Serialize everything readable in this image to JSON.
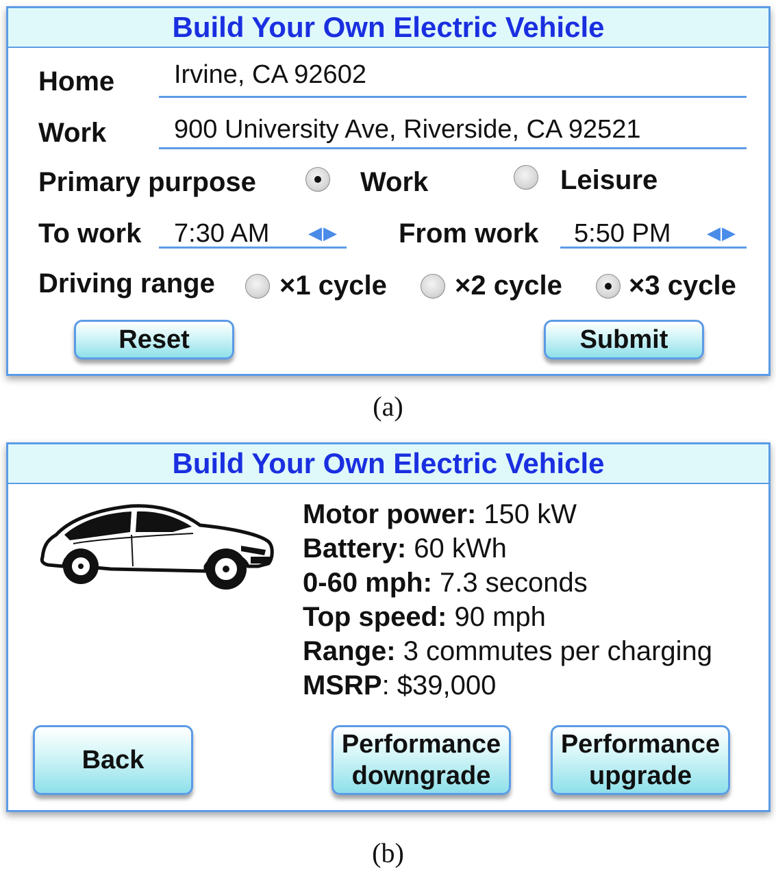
{
  "panel_a": {
    "title": "Build Your Own Electric Vehicle",
    "home_label": "Home",
    "home_value": "Irvine, CA 92602",
    "work_label": "Work",
    "work_value": "900 University Ave, Riverside, CA 92521",
    "purpose_label": "Primary purpose",
    "purpose_options": [
      "Work",
      "Leisure"
    ],
    "purpose_selected": "Work",
    "to_work_label": "To work",
    "to_work_value": "7:30 AM",
    "from_work_label": "From work",
    "from_work_value": "5:50 PM",
    "stepper_glyph": "◀▶",
    "range_label": "Driving range",
    "range_options": [
      "×1 cycle",
      "×2 cycle",
      "×3 cycle"
    ],
    "range_selected": "×3 cycle",
    "reset_label": "Reset",
    "submit_label": "Submit",
    "caption": "(a)"
  },
  "panel_b": {
    "title": "Build Your Own Electric Vehicle",
    "specs": [
      {
        "key": "Motor power:",
        "value": " 150 kW"
      },
      {
        "key": "Battery:",
        "value": " 60 kWh"
      },
      {
        "key": "0-60 mph:",
        "value": " 7.3 seconds"
      },
      {
        "key": "Top speed:",
        "value": " 90 mph"
      },
      {
        "key": "Range:",
        "value": " 3 commutes per charging"
      },
      {
        "key": "MSRP",
        "value": ": $39,000"
      }
    ],
    "back_label": "Back",
    "downgrade_label_1": "Performance",
    "downgrade_label_2": "downgrade",
    "upgrade_label_1": "Performance",
    "upgrade_label_2": "upgrade",
    "caption": "(b)"
  },
  "colors": {
    "title_text": "#1a2fe0",
    "title_bg": "#dff9fb",
    "border": "#5b9be6",
    "button_gradient_bottom": "#8ee0ea"
  },
  "icons": [
    "radio-button",
    "left-right-stepper-arrows",
    "car-illustration"
  ]
}
